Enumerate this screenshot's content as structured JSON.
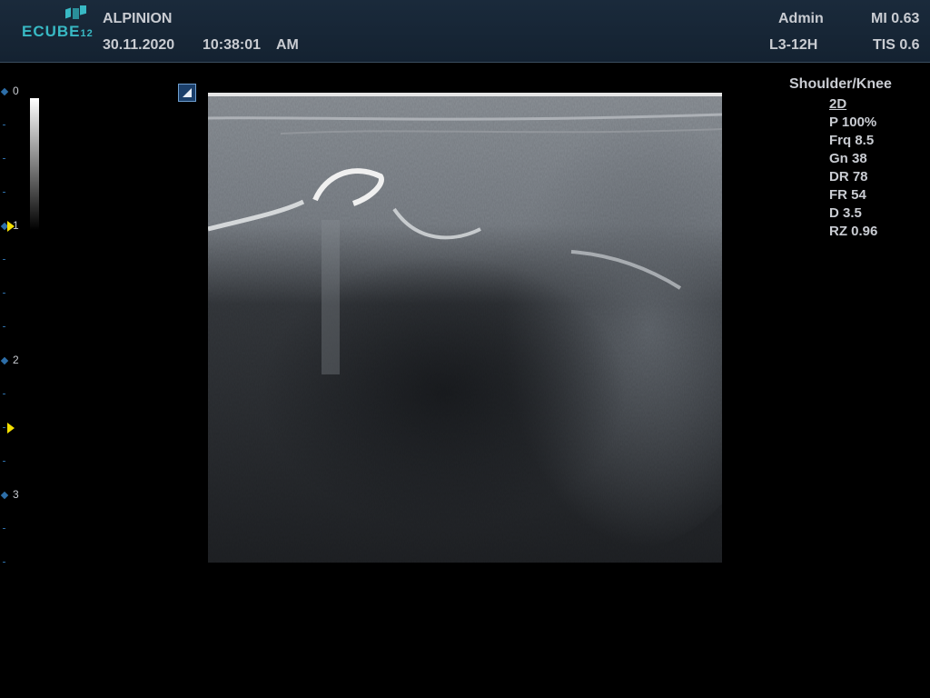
{
  "header": {
    "logo_text": "ECUBE",
    "logo_model": "12",
    "manufacturer": "ALPINION",
    "date": "30.11.2020",
    "time": "10:38:01",
    "ampm": "AM",
    "user": "Admin",
    "probe": "L3-12H",
    "mi": "MI 0.63",
    "tis": "TIS 0.6"
  },
  "depth_scale": {
    "labels": [
      "0",
      "1",
      "2",
      "3"
    ],
    "focus_markers": 2
  },
  "parameters": {
    "preset": "Shoulder/Knee",
    "mode": "2D",
    "items": [
      "P 100%",
      "Frq 8.5",
      "Gn 38",
      "DR 78",
      "FR 54",
      "D 3.5",
      "RZ 0.96"
    ]
  },
  "colors": {
    "header_bg": "#1a2a3b",
    "logo": "#38b9c4",
    "focus_marker": "#f4e000",
    "scale_tick": "#2d6ea8",
    "text": "#c9ccd2"
  }
}
